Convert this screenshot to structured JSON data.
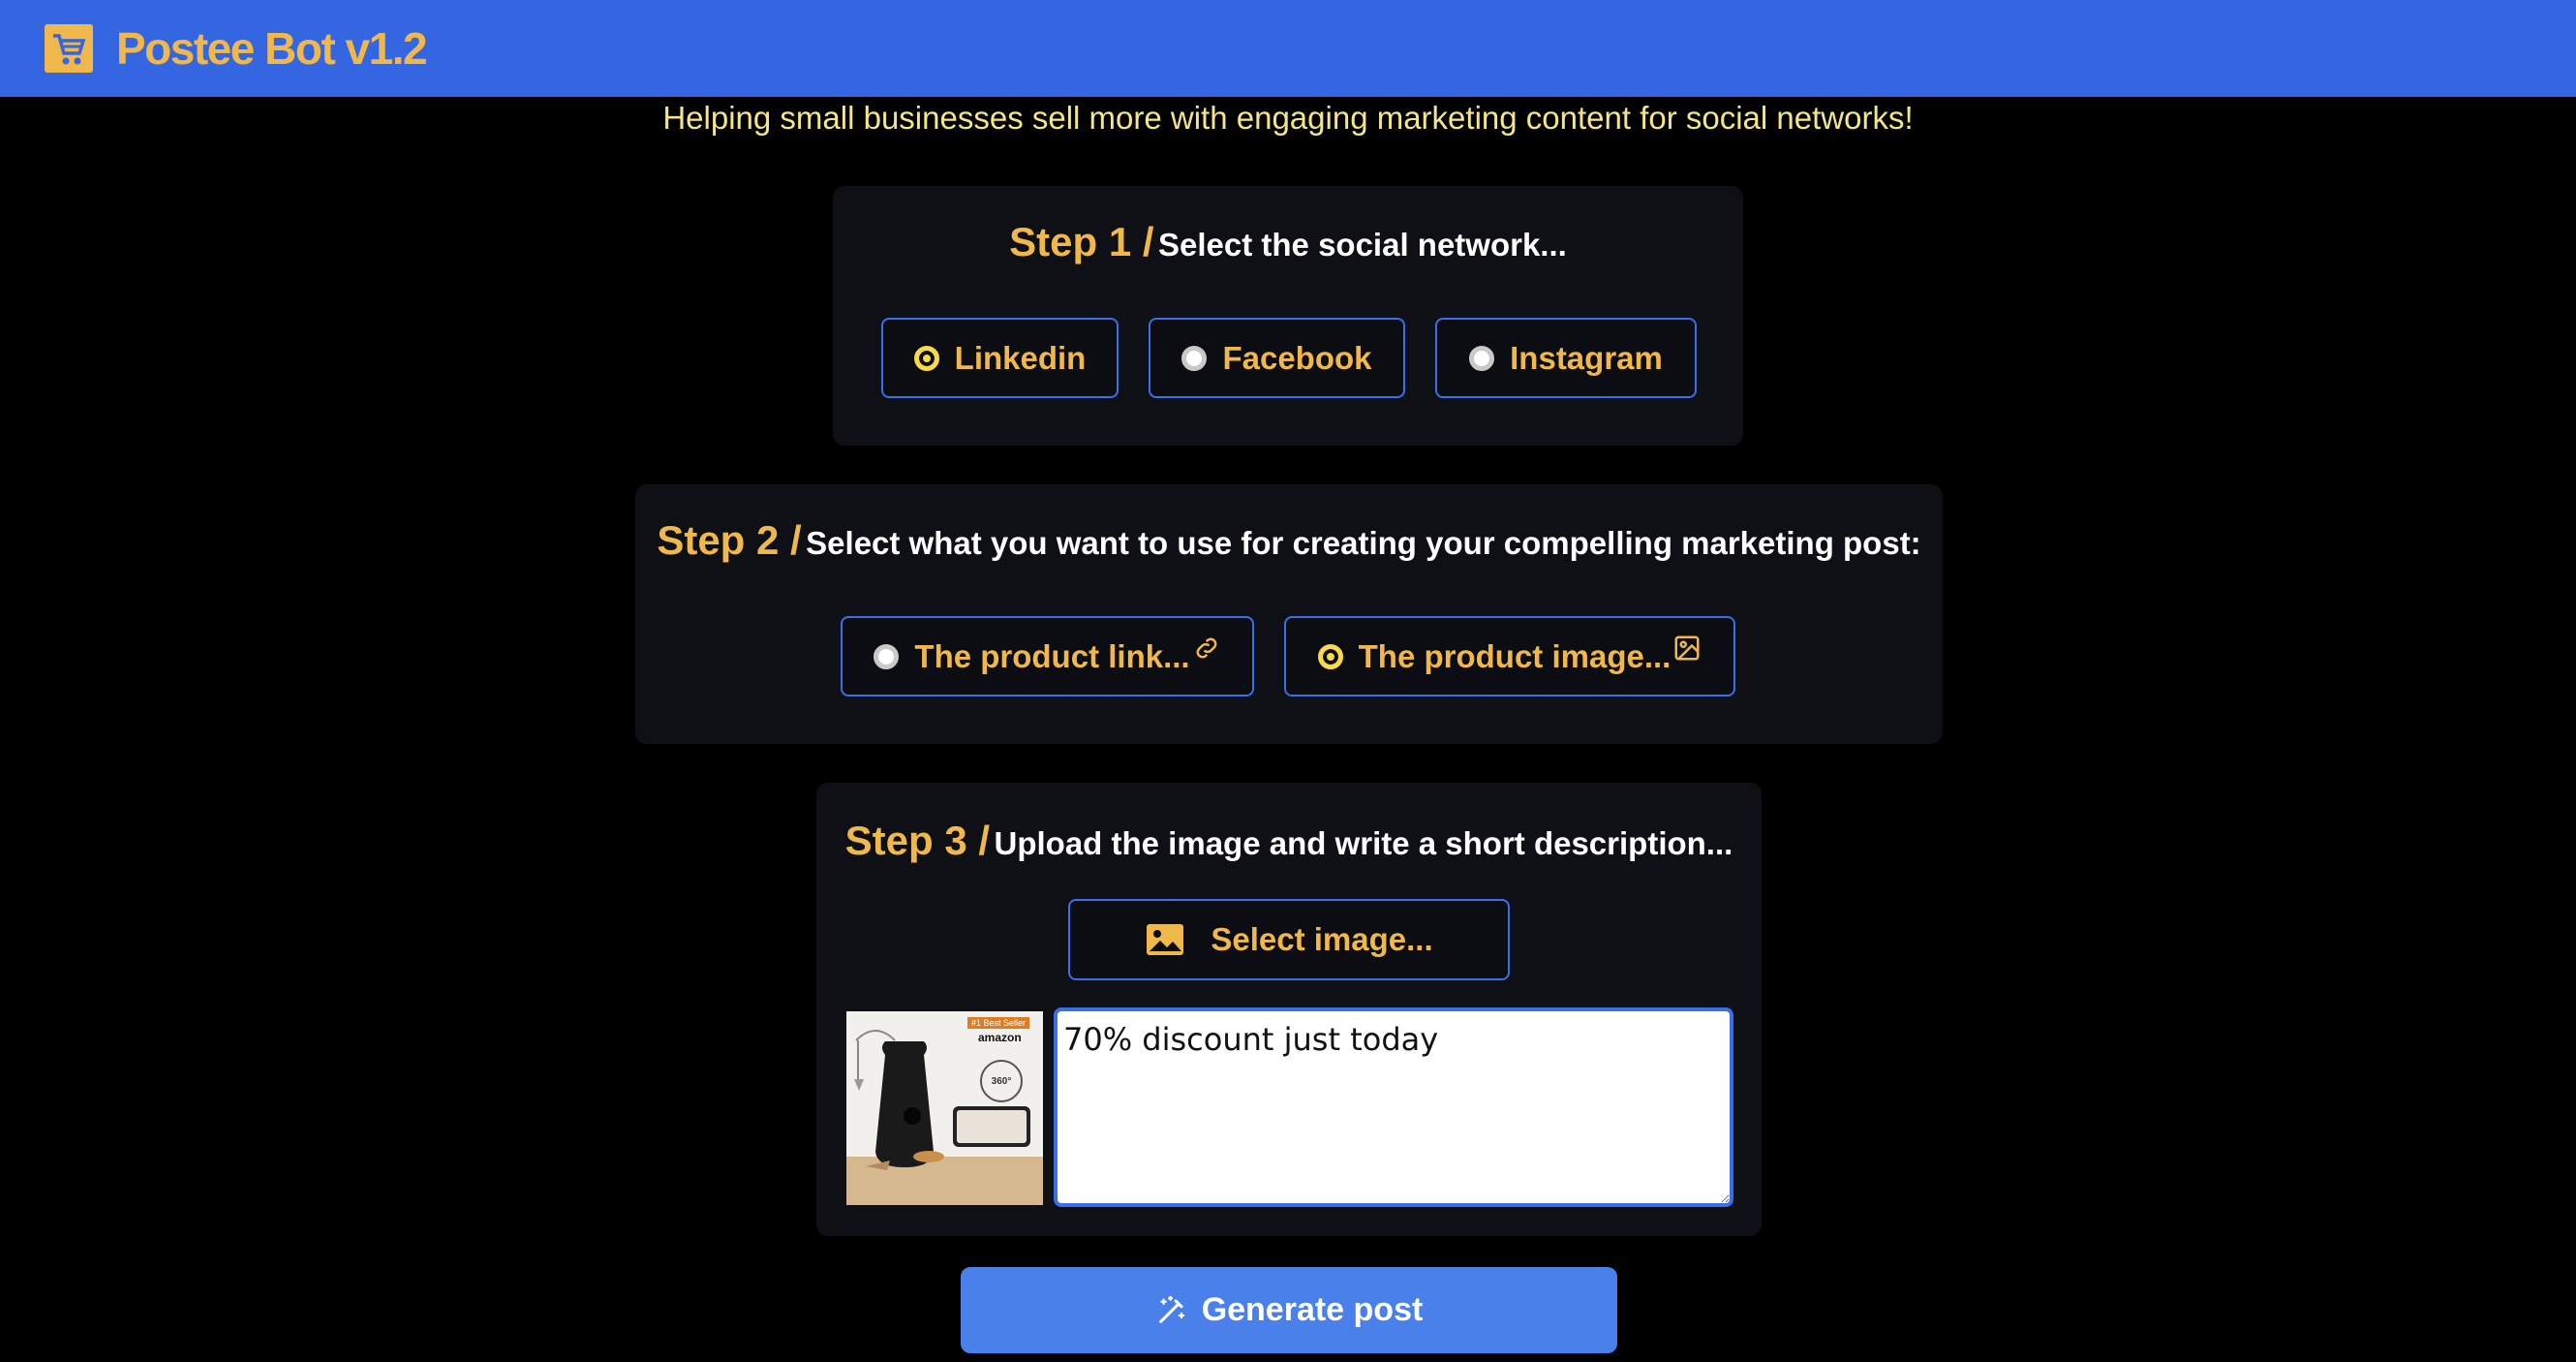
{
  "app": {
    "title": "Postee Bot v1.2",
    "tagline": "Helping small businesses sell more with engaging marketing content for social networks!"
  },
  "step1": {
    "number": "Step 1 /",
    "text": "Select the social network...",
    "options": [
      {
        "label": "Linkedin",
        "selected": true
      },
      {
        "label": "Facebook",
        "selected": false
      },
      {
        "label": "Instagram",
        "selected": false
      }
    ]
  },
  "step2": {
    "number": "Step 2 /",
    "text": "Select what you want to use for creating your compelling marketing post:",
    "options": [
      {
        "label": "The product link...",
        "icon": "link-icon",
        "selected": false
      },
      {
        "label": "The product image...",
        "icon": "image-icon",
        "selected": true
      }
    ]
  },
  "step3": {
    "number": "Step 3 /",
    "text": "Upload the image and write a short description...",
    "select_image_label": "Select image...",
    "description_value": "70% discount just today",
    "thumbnail": {
      "badge": "#1 Best Seller",
      "brand": "amazon",
      "seal": "360°"
    }
  },
  "generate_label": "Generate post",
  "colors": {
    "header": "#3366e0",
    "accent": "#f0b84a",
    "tagline": "#f3e58a",
    "button": "#4a80ea",
    "border": "#3a6fe8"
  }
}
